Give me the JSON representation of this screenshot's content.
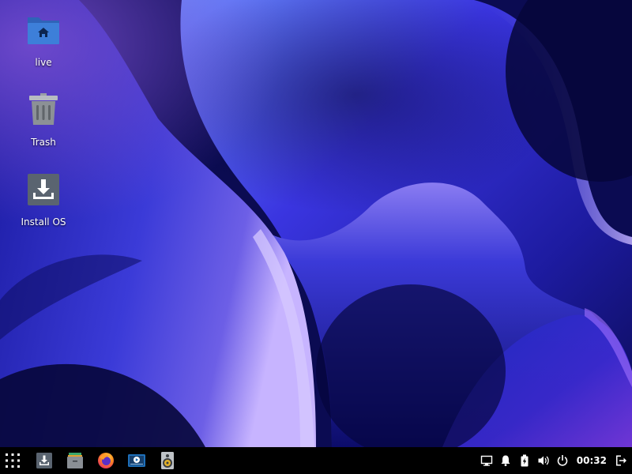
{
  "desktop": {
    "icons": [
      {
        "label": "live",
        "icon": "home-folder-icon"
      },
      {
        "label": "Trash",
        "icon": "trash-icon"
      },
      {
        "label": "Install OS",
        "icon": "install-icon"
      }
    ]
  },
  "taskbar": {
    "launcher_icon": "app-grid-icon",
    "apps": [
      {
        "icon": "installer-icon"
      },
      {
        "icon": "file-manager-icon"
      },
      {
        "icon": "firefox-icon"
      },
      {
        "icon": "video-player-icon"
      },
      {
        "icon": "audio-player-icon"
      }
    ],
    "tray": {
      "icons": [
        "display-icon",
        "notification-bell-icon",
        "battery-icon",
        "volume-icon",
        "power-icon"
      ],
      "clock": "00:32",
      "logout_icon": "logout-icon"
    }
  },
  "colors": {
    "taskbar_bg": "#000000",
    "wallpaper_base": "#0a0a45",
    "folder_blue": "#3d7fd9",
    "install_gray": "#5a6470"
  }
}
